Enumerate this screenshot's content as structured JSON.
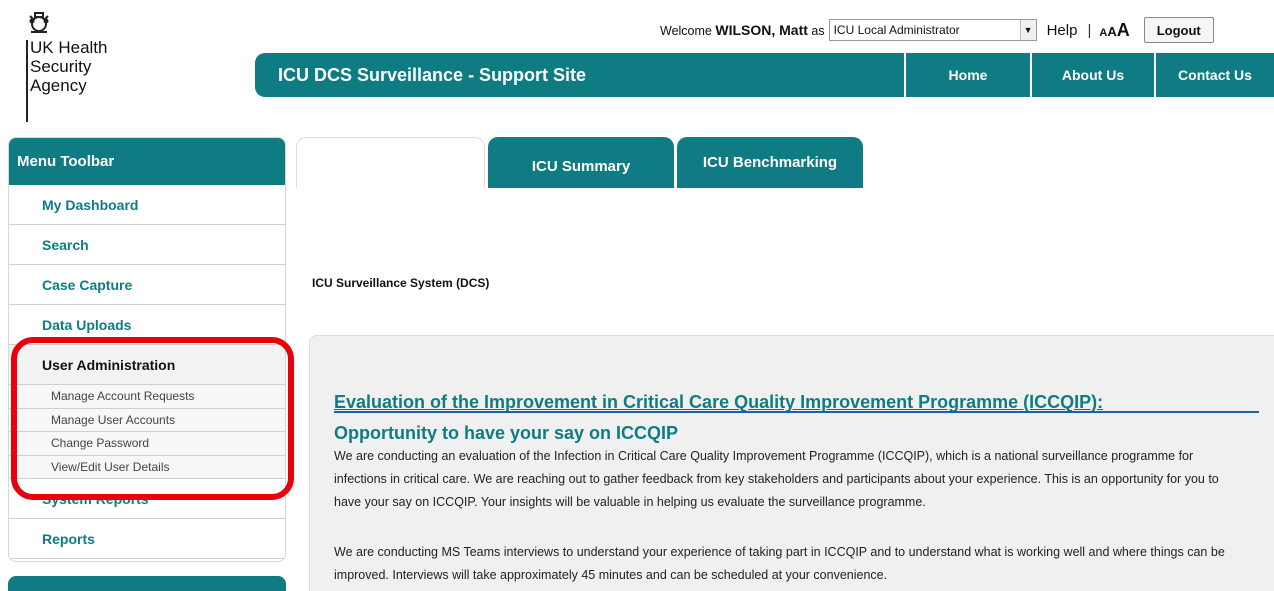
{
  "logo": {
    "name": "UK Health\nSecurity\nAgency",
    "crest_icon": "royal-crest-icon"
  },
  "topbar": {
    "welcome_prefix": "Welcome",
    "user_name": "WILSON, Matt",
    "as_text": "as",
    "role_selected": "ICU Local Administrator",
    "help_label": "Help",
    "separator": "|",
    "text_size_small": "A",
    "text_size_medium": "A",
    "text_size_large": "A",
    "logout_label": "Logout"
  },
  "header": {
    "title": "ICU DCS Surveillance - Support Site",
    "nav": {
      "home": "Home",
      "about": "About Us",
      "contact": "Contact Us"
    },
    "color": "#0f7c83"
  },
  "sidebar": {
    "title": "Menu Toolbar",
    "items": [
      {
        "label": "My Dashboard"
      },
      {
        "label": "Search"
      },
      {
        "label": "Case Capture"
      },
      {
        "label": "Data Uploads"
      },
      {
        "label": "User Administration"
      },
      {
        "label": "System Reports"
      },
      {
        "label": "Reports"
      }
    ],
    "sub_items": [
      {
        "label": "Manage Account Requests"
      },
      {
        "label": "Manage User Accounts"
      },
      {
        "label": "Change Password"
      },
      {
        "label": "View/Edit User Details"
      }
    ]
  },
  "highlight_color": "#e8000b",
  "tabs": {
    "blank": "",
    "summary": "ICU Summary",
    "benchmarking": "ICU Benchmarking"
  },
  "main": {
    "system_label": "ICU Surveillance System (DCS)",
    "heading": "Evaluation of the Improvement in Critical Care Quality Improvement Programme (ICCQIP):",
    "subheading": "Opportunity to have your say on ICCQIP",
    "paragraph1": "We are conducting an evaluation of the Infection in Critical Care Quality Improvement Programme (ICCQIP), which is a national surveillance programme for infections in critical care. We are reaching out to gather feedback from key stakeholders and participants about your experience. This is an opportunity for you to have your say on ICCQIP. Your insights will be valuable in helping us evaluate the surveillance programme.",
    "paragraph2": "We are conducting MS Teams interviews to understand your experience of taking part in ICCQIP and to understand what is working well and where things can be improved. Interviews will take approximately 45 minutes and can be scheduled at your convenience."
  }
}
